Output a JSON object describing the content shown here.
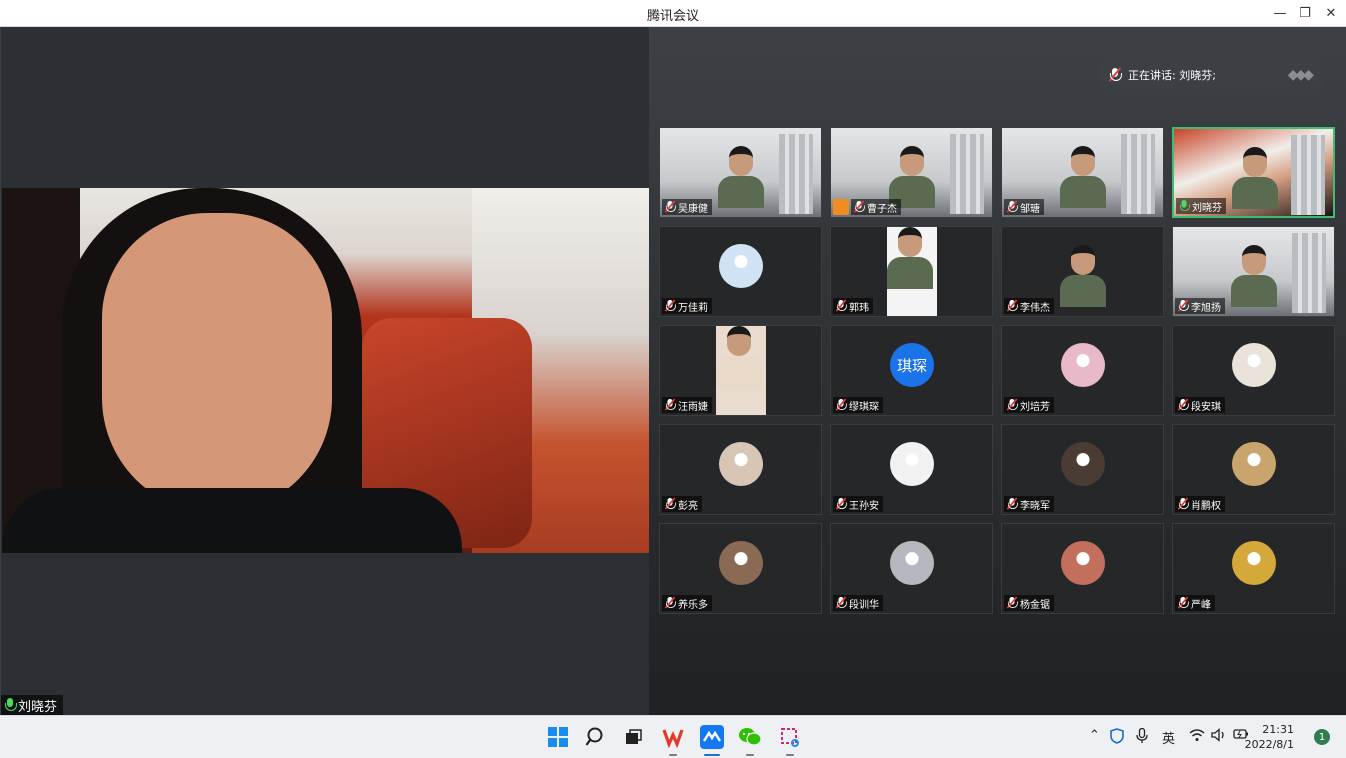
{
  "window": {
    "title": "腾讯会议"
  },
  "main_video": {
    "speaker_name": "刘晓芬"
  },
  "gallery": {
    "speaking_prefix": "正在讲话:",
    "speaking_names": "刘晓芬;",
    "participants": [
      {
        "name": "吴康健",
        "video": "camera"
      },
      {
        "name": "曹子杰",
        "video": "camera",
        "host": true
      },
      {
        "name": "邹瑭",
        "video": "camera"
      },
      {
        "name": "刘晓芬",
        "video": "camera",
        "speaking": true
      },
      {
        "name": "万佳莉",
        "video": "avatar"
      },
      {
        "name": "郭玮",
        "video": "camera"
      },
      {
        "name": "李伟杰",
        "video": "camera"
      },
      {
        "name": "李旭扬",
        "video": "camera"
      },
      {
        "name": "汪雨婕",
        "video": "camera"
      },
      {
        "name": "缪琪琛",
        "video": "avatar",
        "avatar_text": "琪琛"
      },
      {
        "name": "刘培芳",
        "video": "avatar"
      },
      {
        "name": "段安琪",
        "video": "avatar"
      },
      {
        "name": "彭亮",
        "video": "avatar"
      },
      {
        "name": "王孙安",
        "video": "avatar"
      },
      {
        "name": "李晓军",
        "video": "avatar"
      },
      {
        "name": "肖鹏权",
        "video": "avatar"
      },
      {
        "name": "养乐多",
        "video": "avatar"
      },
      {
        "name": "段训华",
        "video": "avatar"
      },
      {
        "name": "杨金锯",
        "video": "avatar"
      },
      {
        "name": "严峰",
        "video": "avatar"
      }
    ]
  },
  "taskbar": {
    "apps": [
      "windows-start-icon",
      "search-icon",
      "task-view-icon",
      "wps-icon",
      "tencent-meeting-icon",
      "wechat-icon",
      "snipping-tool-icon"
    ],
    "ime": "英",
    "time": "21:31",
    "date": "2022/8/1",
    "notifications": "1"
  }
}
